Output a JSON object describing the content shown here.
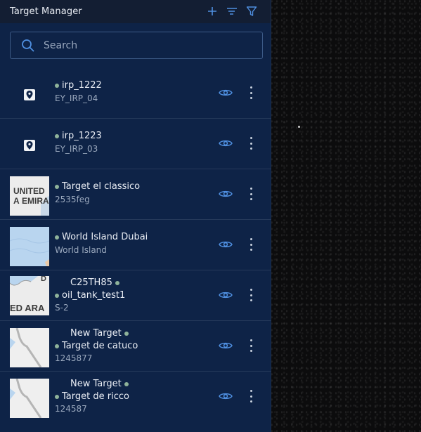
{
  "panel": {
    "title": "Target Manager",
    "actions": {
      "add_icon": "plus-icon",
      "sort_icon": "sort-icon",
      "filter_icon": "filter-icon"
    }
  },
  "search": {
    "placeholder": "Search",
    "value": ""
  },
  "targets": [
    {
      "name": "irp_1222",
      "subtitle": "EY_IRP_04",
      "thumbnail": "pin",
      "status_color": "#8fb39a"
    },
    {
      "name": "irp_1223",
      "subtitle": "EY_IRP_03",
      "thumbnail": "pin",
      "status_color": "#8fb39a"
    },
    {
      "name": "Target el classico",
      "subtitle": "2535feg",
      "thumbnail": "map-uae",
      "thumb_labels": [
        "UNITED A",
        "EMIRA"
      ],
      "status_color": "#8fb39a"
    },
    {
      "name": "World Island Dubai",
      "subtitle": "World Island",
      "thumbnail": "map-island",
      "status_color": "#8fb39a"
    },
    {
      "prefix": "C25TH85",
      "name": "oil_tank_test1",
      "subtitle": "S-2",
      "thumbnail": "map-arab",
      "thumb_labels": [
        "ED ARA",
        "D"
      ],
      "status_color": "#8fb39a"
    },
    {
      "prefix": "New Target",
      "name": "Target de catuco",
      "subtitle": "1245877",
      "thumbnail": "map-road",
      "status_color": "#8fb39a"
    },
    {
      "prefix": "New Target",
      "name": "Target de ricco",
      "subtitle": "124587",
      "thumbnail": "map-road",
      "status_color": "#8fb39a"
    }
  ],
  "colors": {
    "panel_bg": "#0e2347",
    "header_bg": "#131e33",
    "accent": "#4f8fe0",
    "status_dot": "#8fb39a"
  }
}
